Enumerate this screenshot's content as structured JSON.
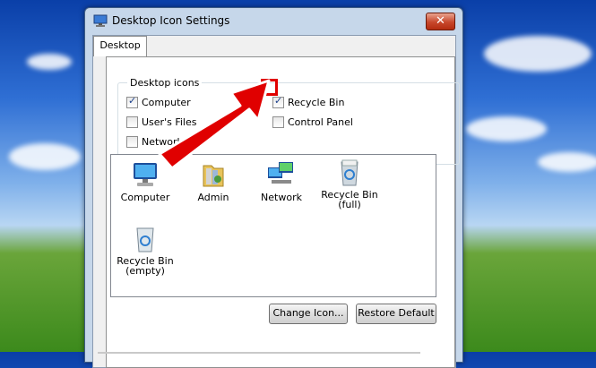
{
  "dialog": {
    "title": "Desktop Icon Settings",
    "close_glyph": "✕",
    "tab": "Desktop",
    "group_label": "Desktop icons",
    "checkboxes": [
      {
        "label": "Computer",
        "checked": true
      },
      {
        "label": "User's Files",
        "checked": false
      },
      {
        "label": "Network",
        "checked": false
      },
      {
        "label": "Recycle Bin",
        "checked": true
      },
      {
        "label": "Control Panel",
        "checked": false
      }
    ],
    "icons": [
      {
        "label": "Computer",
        "icon": "computer-icon"
      },
      {
        "label": "Admin",
        "icon": "user-folder-icon"
      },
      {
        "label": "Network",
        "icon": "network-icon"
      },
      {
        "label": "Recycle Bin\n(full)",
        "icon": "recycle-bin-full-icon"
      },
      {
        "label": "Recycle Bin\n(empty)",
        "icon": "recycle-bin-empty-icon"
      }
    ],
    "change_icon_label": "Change Icon...",
    "restore_default_label": "Restore Default"
  },
  "annotation": {
    "color": "#e00000"
  }
}
